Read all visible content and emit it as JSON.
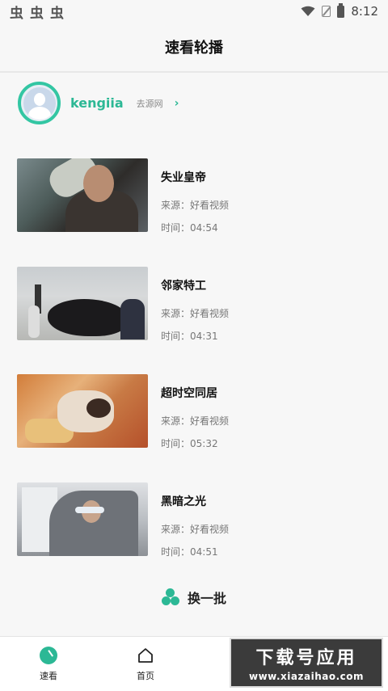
{
  "status_bar": {
    "left_icons": [
      "chong-icon",
      "chong-icon",
      "chong-icon"
    ],
    "left_glyph": "虫",
    "time": "8:12"
  },
  "header": {
    "title": "速看轮播"
  },
  "user": {
    "name": "kengiia",
    "source_link": "去源网"
  },
  "videos": [
    {
      "title": "失业皇帝",
      "source": "来源：好看视频",
      "duration": "时间：04:54"
    },
    {
      "title": "邻家特工",
      "source": "来源：好看视频",
      "duration": "时间：04:31"
    },
    {
      "title": "超时空同居",
      "source": "来源：好看视频",
      "duration": "时间：05:32"
    },
    {
      "title": "黑暗之光",
      "source": "来源：好看视频",
      "duration": "时间：04:51"
    }
  ],
  "refresh": {
    "label": "换一批"
  },
  "bottom_nav": {
    "items": [
      {
        "label": "速看",
        "icon": "speed-watch-icon",
        "active": true
      },
      {
        "label": "首页",
        "icon": "home-icon",
        "active": false
      }
    ]
  },
  "watermark": {
    "main": "下载号应用",
    "sub": "www.xiazaihao.com"
  },
  "colors": {
    "accent": "#2cb895",
    "background": "#f7f7f7"
  }
}
